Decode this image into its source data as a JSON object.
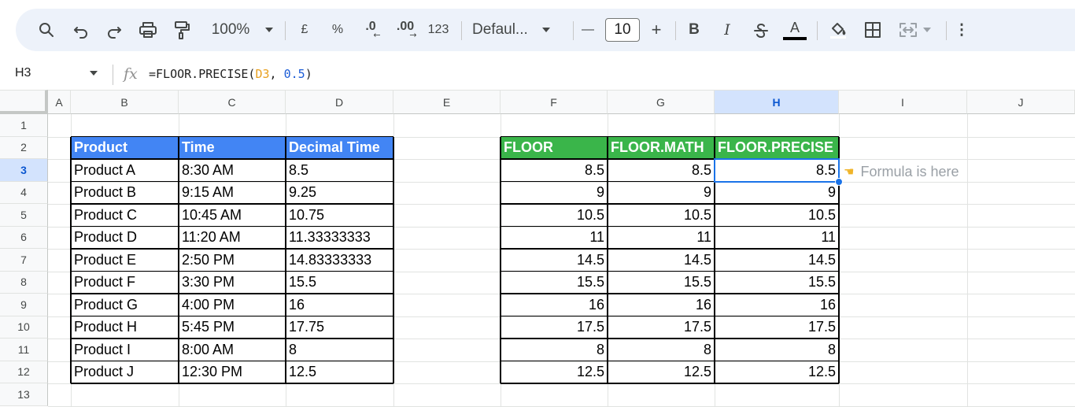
{
  "toolbar": {
    "zoom": "100%",
    "currency": "£",
    "percent": "%",
    "dec_decrease": ".0",
    "dec_increase": ".00",
    "number_format": "123",
    "font": "Defaul...",
    "font_size": "10",
    "minus": "—",
    "plus": "+",
    "bold": "B",
    "italic": "I",
    "text_color_letter": "A",
    "more": "⋮"
  },
  "formula_bar": {
    "cell_ref": "H3",
    "fx": "fx",
    "formula_prefix": "=FLOOR.PRECISE(",
    "formula_ref": "D3",
    "formula_sep": ", ",
    "formula_num": "0.5",
    "formula_suffix": ")"
  },
  "columns": [
    "A",
    "B",
    "C",
    "D",
    "E",
    "F",
    "G",
    "H",
    "I",
    "J"
  ],
  "selected_column": "H",
  "rows": [
    "1",
    "2",
    "3",
    "4",
    "5",
    "6",
    "7",
    "8",
    "9",
    "10",
    "11",
    "12",
    "13"
  ],
  "selected_row": "3",
  "table1": {
    "headers": [
      "Product",
      "Time",
      "Decimal Time"
    ],
    "rows": [
      [
        "Product A",
        "8:30 AM",
        "8.5"
      ],
      [
        "Product B",
        "9:15 AM",
        "9.25"
      ],
      [
        "Product C",
        "10:45 AM",
        "10.75"
      ],
      [
        "Product D",
        "11:20 AM",
        "11.33333333"
      ],
      [
        "Product E",
        "2:50 PM",
        "14.83333333"
      ],
      [
        "Product F",
        "3:30 PM",
        "15.5"
      ],
      [
        "Product G",
        "4:00 PM",
        "16"
      ],
      [
        "Product H",
        "5:45 PM",
        "17.75"
      ],
      [
        "Product I",
        "8:00 AM",
        "8"
      ],
      [
        "Product J",
        "12:30 PM",
        "12.5"
      ]
    ]
  },
  "table2": {
    "headers": [
      "FLOOR",
      "FLOOR.MATH",
      "FLOOR.PRECISE"
    ],
    "rows": [
      [
        "8.5",
        "8.5",
        "8.5"
      ],
      [
        "9",
        "9",
        "9"
      ],
      [
        "10.5",
        "10.5",
        "10.5"
      ],
      [
        "11",
        "11",
        "11"
      ],
      [
        "14.5",
        "14.5",
        "14.5"
      ],
      [
        "15.5",
        "15.5",
        "15.5"
      ],
      [
        "16",
        "16",
        "16"
      ],
      [
        "17.5",
        "17.5",
        "17.5"
      ],
      [
        "8",
        "8",
        "8"
      ],
      [
        "12.5",
        "12.5",
        "12.5"
      ]
    ]
  },
  "note": "Formula is here",
  "colors": {
    "header_blue": "#4285f4",
    "header_green": "#3ab54a",
    "selection": "#1a73e8",
    "toolbar_bg": "#edf2fa"
  }
}
